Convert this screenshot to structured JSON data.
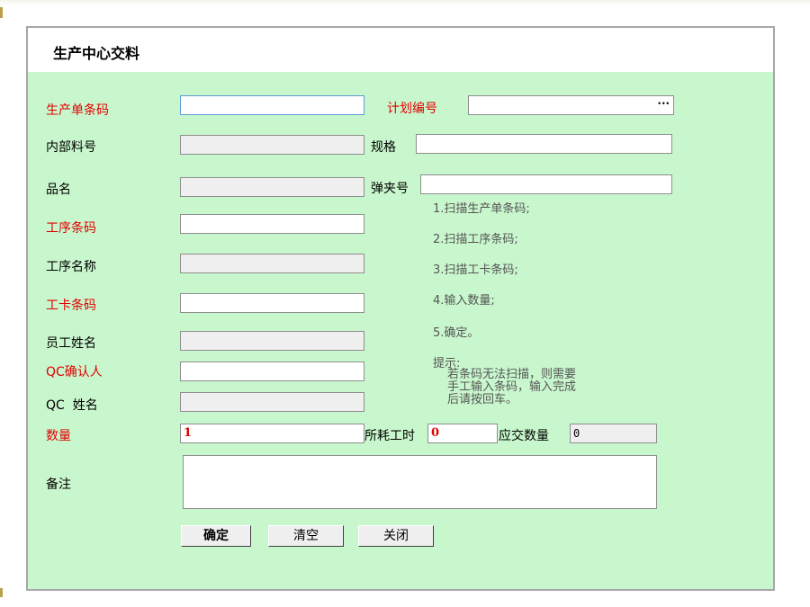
{
  "title": "生产中心交料",
  "labels": {
    "production_barcode": "生产单条码",
    "plan_no": "计划编号",
    "internal_part_no": "内部料号",
    "spec": "规格",
    "product_name": "品名",
    "clamp_no": "弹夹号",
    "process_barcode": "工序条码",
    "process_name": "工序名称",
    "work_card_barcode": "工卡条码",
    "employee_name": "员工姓名",
    "qc_confirmer": "QC确认人",
    "qc_name": "QC  姓名",
    "quantity": "数量",
    "hours_spent": "所耗工时",
    "due_quantity": "应交数量",
    "remarks": "备注"
  },
  "values": {
    "production_barcode": "",
    "plan_no": "",
    "plan_no_browse": "...",
    "internal_part_no": "",
    "spec": "",
    "product_name": "",
    "clamp_no": "",
    "process_barcode": "",
    "process_name": "",
    "work_card_barcode": "",
    "employee_name": "",
    "qc_confirmer": "",
    "qc_name": "",
    "quantity": "1",
    "hours_spent": "0",
    "due_quantity": "0",
    "remarks": ""
  },
  "steps": [
    "1.扫描生产单条码;",
    "2.扫描工序条码;",
    "3.扫描工卡条码;",
    "4.输入数量;",
    "5.确定。"
  ],
  "tip": {
    "heading": "提示:",
    "lines": [
      "若条码无法扫描，则需要",
      "手工输入条码，输入完成",
      "后请按回车。"
    ]
  },
  "buttons": {
    "confirm": "确定",
    "clear": "清空",
    "close": "关闭"
  },
  "colors": {
    "panel_bg": "#c9f7cd",
    "required_label": "#e00000",
    "readonly_field": "#efefef"
  }
}
